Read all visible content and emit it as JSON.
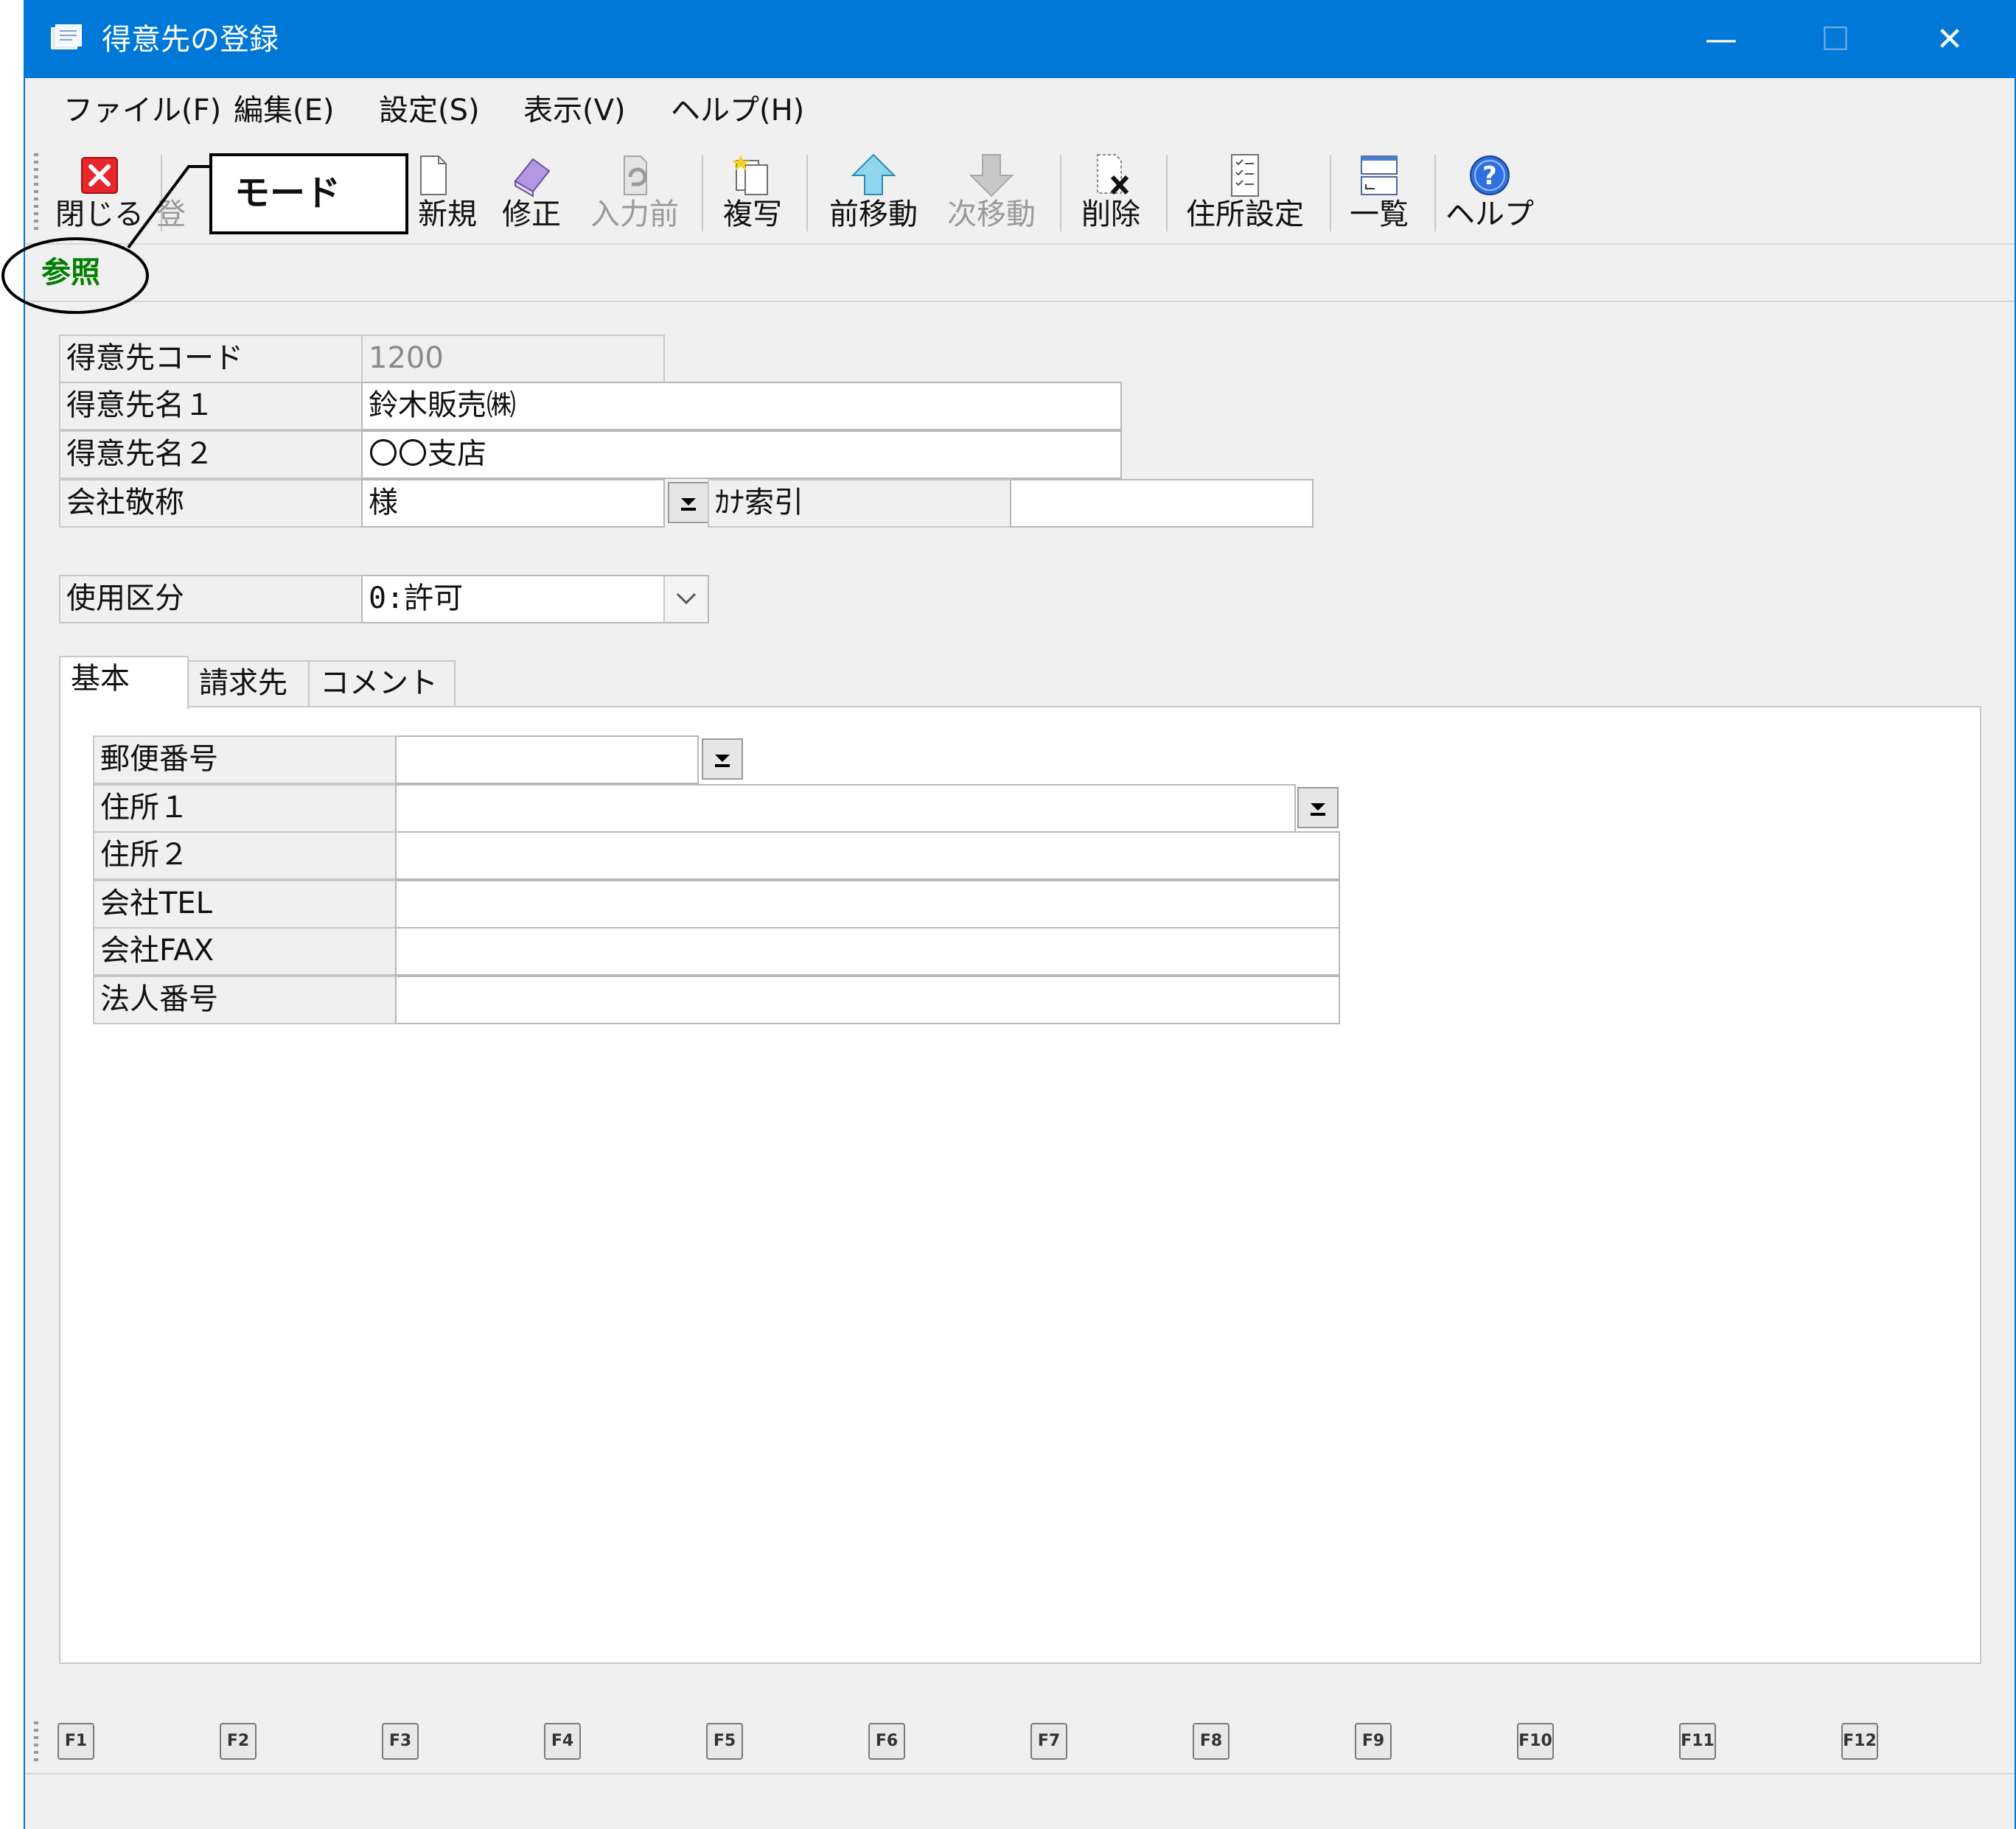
{
  "window": {
    "title": "得意先の登録",
    "minimize": "—",
    "maximize": "☐",
    "close": "✕"
  },
  "menu": [
    "ファイル(F)",
    "編集(E)",
    "設定(S)",
    "表示(V)",
    "ヘルプ(H)"
  ],
  "toolbar": {
    "close": "閉じる",
    "register": "登",
    "new": "新規",
    "modify": "修正",
    "before_input": "入力前",
    "copy": "複写",
    "prev": "前移動",
    "next": "次移動",
    "delete": "削除",
    "address_setting": "住所設定",
    "list": "一覧",
    "help": "ヘルプ"
  },
  "mode": {
    "value": "参照"
  },
  "callout": {
    "label": "モード"
  },
  "fields": {
    "code_label": "得意先コード",
    "code_value": "1200",
    "name1_label": "得意先名１",
    "name1_value": "鈴木販売㈱",
    "name2_label": "得意先名２",
    "name2_value": "〇〇支店",
    "honorific_label": "会社敬称",
    "honorific_value": "様",
    "kana_label": "ｶﾅ索引",
    "kana_value": "",
    "usage_label": "使用区分",
    "usage_value": "0:許可"
  },
  "tabs": [
    "基本",
    "請求先",
    "コメント"
  ],
  "basic": {
    "postal_label": "郵便番号",
    "postal_value": "",
    "address1_label": "住所１",
    "address1_value": "",
    "address2_label": "住所２",
    "address2_value": "",
    "tel_label": "会社TEL",
    "tel_value": "",
    "fax_label": "会社FAX",
    "fax_value": "",
    "corp_no_label": "法人番号",
    "corp_no_value": ""
  },
  "fkeys": [
    "F1",
    "F2",
    "F3",
    "F4",
    "F5",
    "F6",
    "F7",
    "F8",
    "F9",
    "F10",
    "F11",
    "F12"
  ]
}
